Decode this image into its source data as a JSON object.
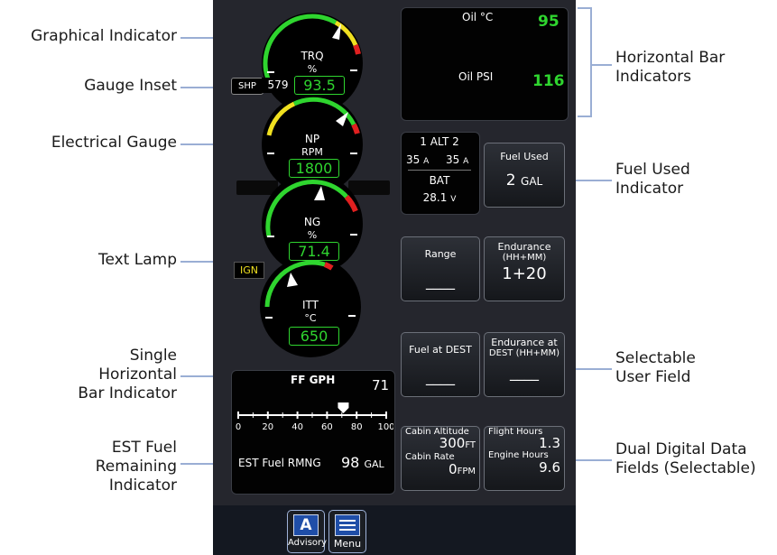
{
  "callouts": {
    "graphical_indicator": "Graphical Indicator",
    "gauge_inset": "Gauge Inset",
    "electrical_gauge": "Electrical Gauge",
    "text_lamp": "Text Lamp",
    "single_bar": [
      "Single",
      "Horizontal",
      "Bar Indicator"
    ],
    "est_fuel": [
      "EST Fuel",
      "Remaining",
      "Indicator"
    ],
    "horizontal_bar": [
      "Horizontal Bar",
      "Indicators"
    ],
    "fuel_used": [
      "Fuel Used",
      "Indicator"
    ],
    "selectable_field": [
      "Selectable",
      "User Field"
    ],
    "dual_digital": [
      "Dual Digital Data",
      "Fields (Selectable)"
    ]
  },
  "gauges": {
    "trq": {
      "label": "TRQ",
      "unit": "%",
      "value": "93.5",
      "inset_label": "SHP",
      "inset_value": "579"
    },
    "np": {
      "label": "NP",
      "unit": "RPM",
      "value": "1800"
    },
    "ng": {
      "label": "NG",
      "unit": "%",
      "value": "71.4"
    },
    "itt": {
      "label": "ITT",
      "unit": "°C",
      "value": "650"
    }
  },
  "lamp": {
    "text": "IGN"
  },
  "oil": {
    "temp_label": "Oil °C",
    "temp_value": "95",
    "psi_label": "Oil PSI",
    "psi_value": "116"
  },
  "electrical": {
    "header": "1 ALT 2",
    "amp_left": "35",
    "amp_right": "35",
    "amp_unit": "A",
    "bat_label": "BAT",
    "bat_value": "28.1",
    "bat_unit": "V"
  },
  "fuel_used": {
    "label": "Fuel Used",
    "value": "2",
    "unit": "GAL"
  },
  "range": {
    "label": "Range",
    "value": "____"
  },
  "endurance": {
    "label_1": "Endurance",
    "label_2": "(HH+MM)",
    "value": "1+20"
  },
  "fuel_at_dest": {
    "label": "Fuel at DEST",
    "value": "____"
  },
  "endurance_dest": {
    "label_1": "Endurance at",
    "label_2": "DEST (HH+MM)",
    "value": "____"
  },
  "ff": {
    "label": "FF GPH",
    "value": "71",
    "ticks": [
      "0",
      "20",
      "40",
      "60",
      "80",
      "100"
    ],
    "pointer": 71
  },
  "est_fuel": {
    "label": "EST Fuel RMNG",
    "value": "98",
    "unit": "GAL"
  },
  "cabin": {
    "alt_label": "Cabin Altitude",
    "alt_value": "300",
    "alt_unit": "FT",
    "rate_label": "Cabin Rate",
    "rate_value": "0",
    "rate_unit": "FPM"
  },
  "hours": {
    "flight_label": "Flight Hours",
    "flight_value": "1.3",
    "engine_label": "Engine Hours",
    "engine_value": "9.6"
  },
  "buttons": {
    "advisory": "Advisory",
    "advisory_glyph": "A",
    "menu": "Menu"
  },
  "icons": [
    "advisory-icon",
    "menu-icon"
  ],
  "colors": {
    "green": "#2fd52f",
    "yellow": "#f0e020",
    "red": "#e02020",
    "panel": "#25262d"
  }
}
